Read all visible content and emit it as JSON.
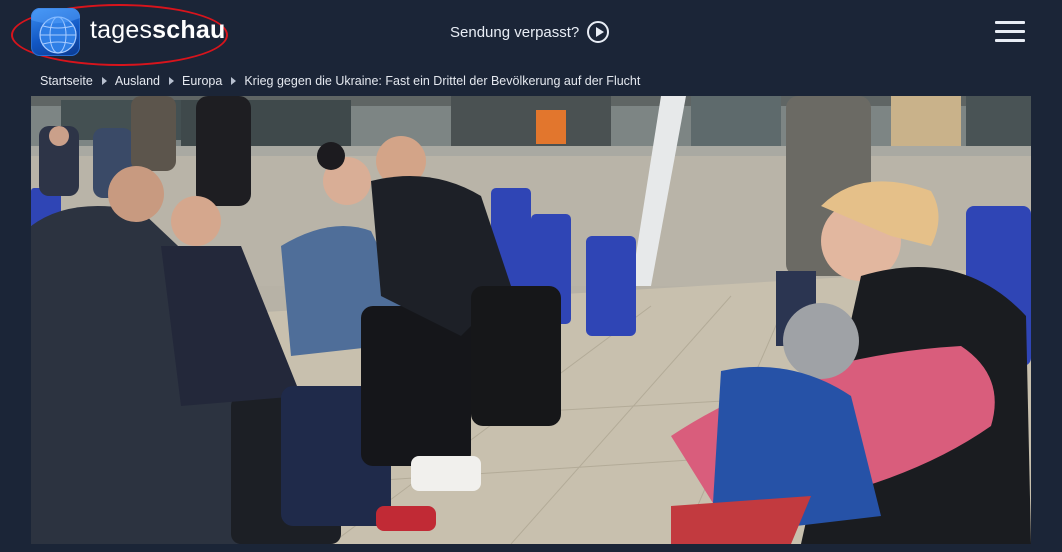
{
  "header": {
    "logo_text_light": "tages",
    "logo_text_bold": "schau",
    "missed_label": "Sendung verpasst?"
  },
  "breadcrumb": [
    {
      "label": "Startseite"
    },
    {
      "label": "Ausland"
    },
    {
      "label": "Europa"
    },
    {
      "label": "Krieg gegen die Ukraine: Fast ein Drittel der Bevölkerung auf der Flucht"
    }
  ],
  "colors": {
    "page_background": "#1b2537",
    "logo_ring": "#d8141c",
    "logo_tile": "#1257c4"
  },
  "icons": {
    "logo": "tagesschau-globe-logo",
    "missed": "play-circle-icon",
    "menu": "hamburger-menu-icon"
  }
}
